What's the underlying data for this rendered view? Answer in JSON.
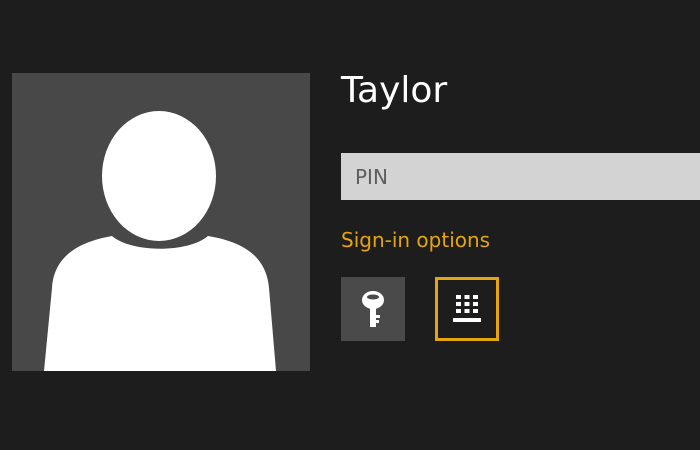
{
  "user": {
    "name": "Taylor"
  },
  "pin_field": {
    "placeholder": "PIN",
    "value": ""
  },
  "sign_in_options": {
    "label": "Sign-in options",
    "options": [
      {
        "id": "password",
        "icon": "key-icon",
        "selected": false
      },
      {
        "id": "pin",
        "icon": "keypad-icon",
        "selected": true
      }
    ]
  },
  "colors": {
    "background": "#1d1d1d",
    "accent": "#e5a50e",
    "tile": "#484848",
    "input": "#d3d3d3"
  }
}
